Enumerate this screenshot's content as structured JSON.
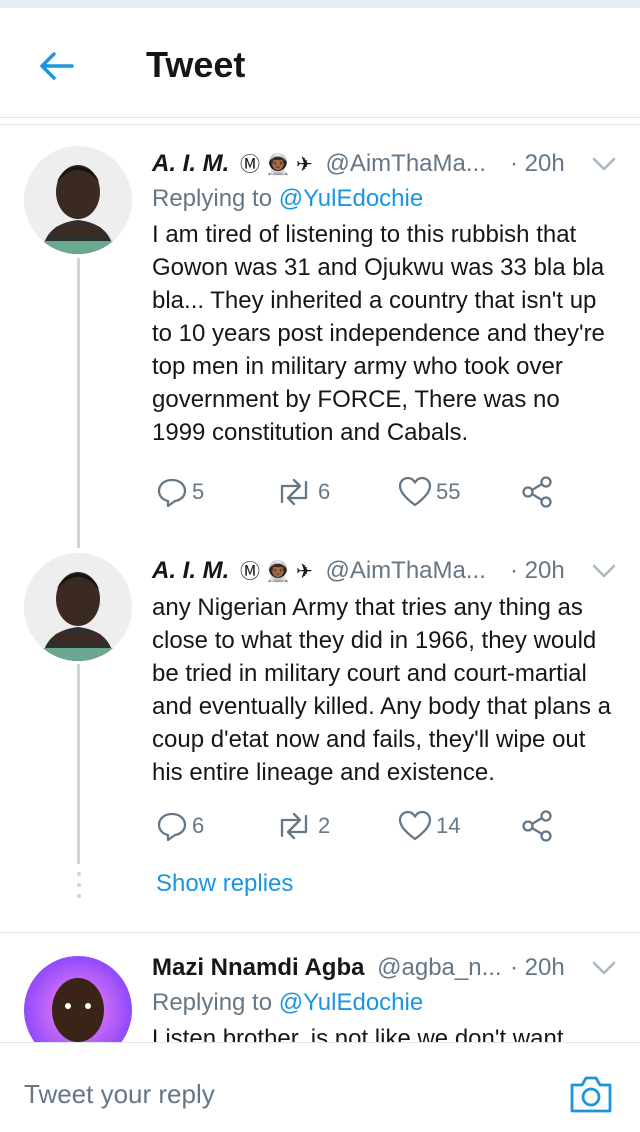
{
  "header": {
    "title": "Tweet"
  },
  "tweets": [
    {
      "name": "A. I. M.",
      "badges": "Ⓜ 👨🏾‍🚀 ✈",
      "handle": "@AimThaMa...",
      "time": "· 20h",
      "replying_prefix": "Replying to",
      "replying_to": "@YulEdochie",
      "text": "I am tired of listening to this rubbish that Gowon was 31 and Ojukwu was 33 bla bla bla... They inherited a country that isn't up to 10 years post independence and they're top men in military army who took over government by FORCE, There was no 1999 constitution and Cabals.",
      "replies": "5",
      "retweets": "6",
      "likes": "55"
    },
    {
      "name": "A. I. M.",
      "badges": "Ⓜ 👨🏾‍🚀 ✈",
      "handle": "@AimThaMa...",
      "time": "· 20h",
      "text": "any Nigerian Army that tries any thing as close to what they did in 1966, they would be tried in military court and court-martial and eventually killed. Any body that plans a coup d'etat now and fails, they'll wipe out his entire lineage and existence.",
      "replies": "6",
      "retweets": "2",
      "likes": "14"
    },
    {
      "name": "Mazi Nnamdi Agba",
      "handle": "@agba_n...",
      "time": "· 20h",
      "replying_prefix": "Replying to",
      "replying_to": "@YulEdochie",
      "text": "Listen brother, is not like we don't want"
    }
  ],
  "show_replies": "Show replies",
  "reply_bar": {
    "placeholder": "Tweet your reply"
  },
  "colors": {
    "accent": "#1b95e0",
    "secondary_text": "#657786",
    "border": "#e1e8ed"
  }
}
